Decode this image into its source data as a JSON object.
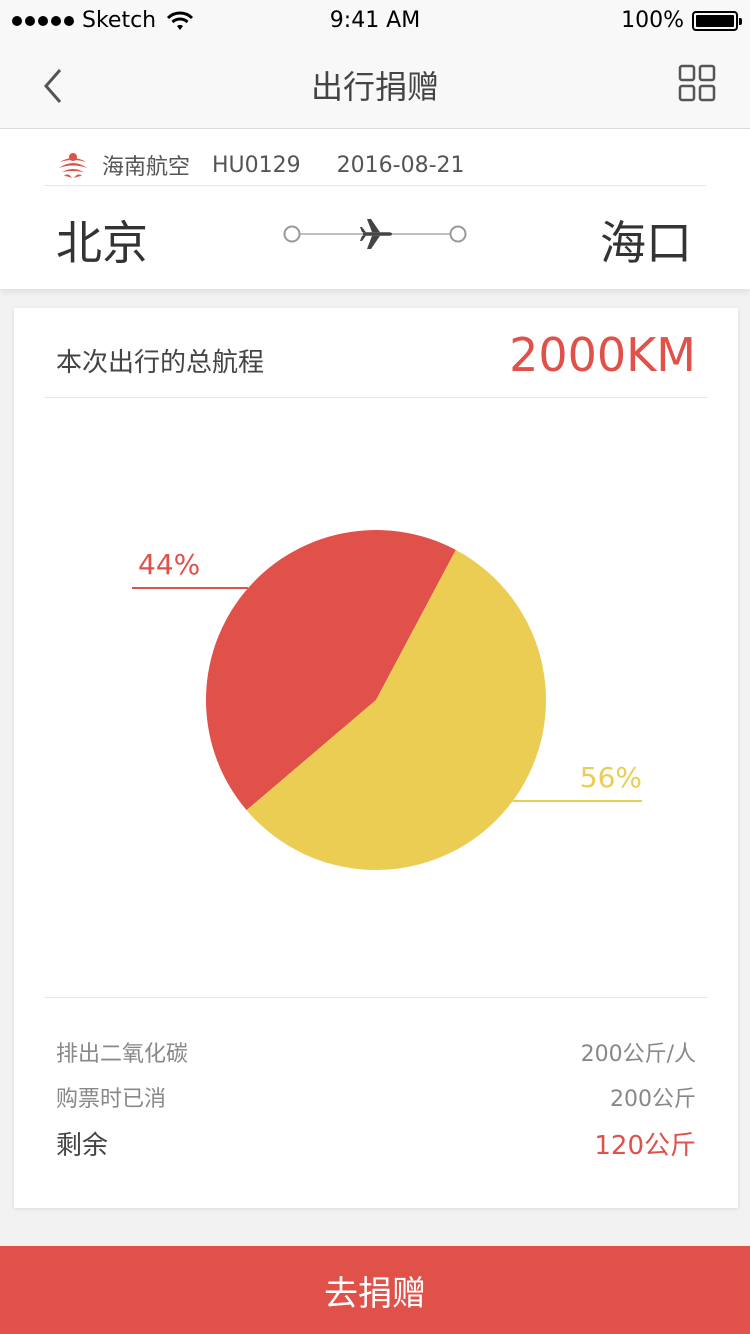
{
  "status_bar": {
    "carrier": "Sketch",
    "time": "9:41 AM",
    "battery": "100%",
    "battery_level": 1.0
  },
  "nav": {
    "title": "出行捐赠",
    "back_icon": "chevron-left-icon",
    "menu_icon": "grid-icon"
  },
  "flight": {
    "airline": "海南航空",
    "flight_number": "HU0129",
    "date": "2016-08-21",
    "from": "北京",
    "to": "海口",
    "plane_icon": "airplane-icon"
  },
  "summary": {
    "total_label": "本次出行的总航程",
    "total_value": "2000KM"
  },
  "chart_data": {
    "type": "pie",
    "slices": [
      {
        "label": "44%",
        "value": 44,
        "color": "#e0514a"
      },
      {
        "label": "56%",
        "value": 56,
        "color": "#ebcd54"
      }
    ]
  },
  "stats": {
    "emission_label": "排出二氧化碳",
    "emission_value": "200公斤/人",
    "offset_label": "购票时已消",
    "offset_value": "200公斤",
    "remain_label": "剩余",
    "remain_value": "120公斤"
  },
  "button": {
    "label": "去捐赠"
  },
  "colors": {
    "accent": "#e0514a",
    "secondary": "#ebcd54"
  }
}
